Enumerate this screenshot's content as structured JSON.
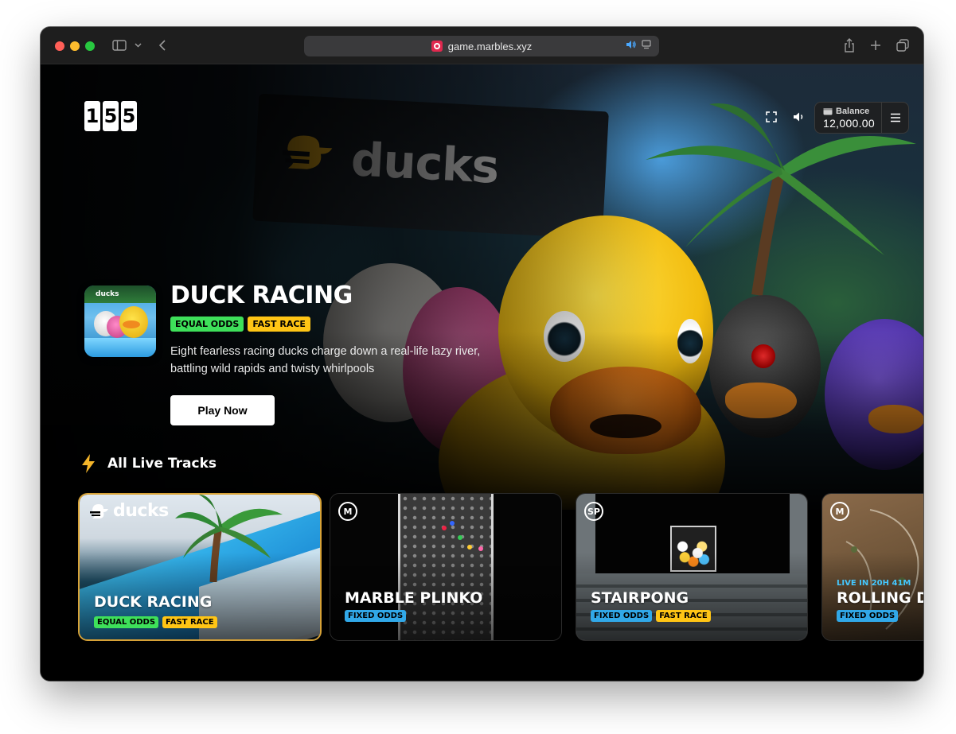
{
  "browser": {
    "url": "game.marbles.xyz"
  },
  "header": {
    "logo_digits": [
      "1",
      "5",
      "5"
    ],
    "balance_label": "Balance",
    "balance_value": "12,000.00"
  },
  "featured": {
    "title": "DUCK RACING",
    "tags": [
      "EQUAL ODDS",
      "FAST RACE"
    ],
    "description": "Eight fearless racing ducks charge down a real-life lazy river, battling wild rapids and twisty whirlpools",
    "play_label": "Play Now",
    "thumb_label": "ducks",
    "bg_sign_text": "ducks"
  },
  "section": {
    "title": "All Live Tracks"
  },
  "tracks": [
    {
      "title": "DUCK RACING",
      "logo": "ducks",
      "tags": [
        "EQUAL ODDS",
        "FAST RACE"
      ]
    },
    {
      "title": "MARBLE PLINKO",
      "badge": "M",
      "tags": [
        "FIXED ODDS"
      ]
    },
    {
      "title": "STAIRPONG",
      "badge": "SP",
      "tags": [
        "FIXED ODDS",
        "FAST RACE"
      ]
    },
    {
      "title": "ROLLING D",
      "badge": "M",
      "live": "LIVE IN 20H 41M",
      "tags": [
        "FIXED ODDS"
      ]
    }
  ],
  "colors": {
    "tag_green": "#3ee05a",
    "tag_yellow": "#ffc515",
    "tag_blue": "#31a8e8",
    "active_border": "#d7a237"
  }
}
